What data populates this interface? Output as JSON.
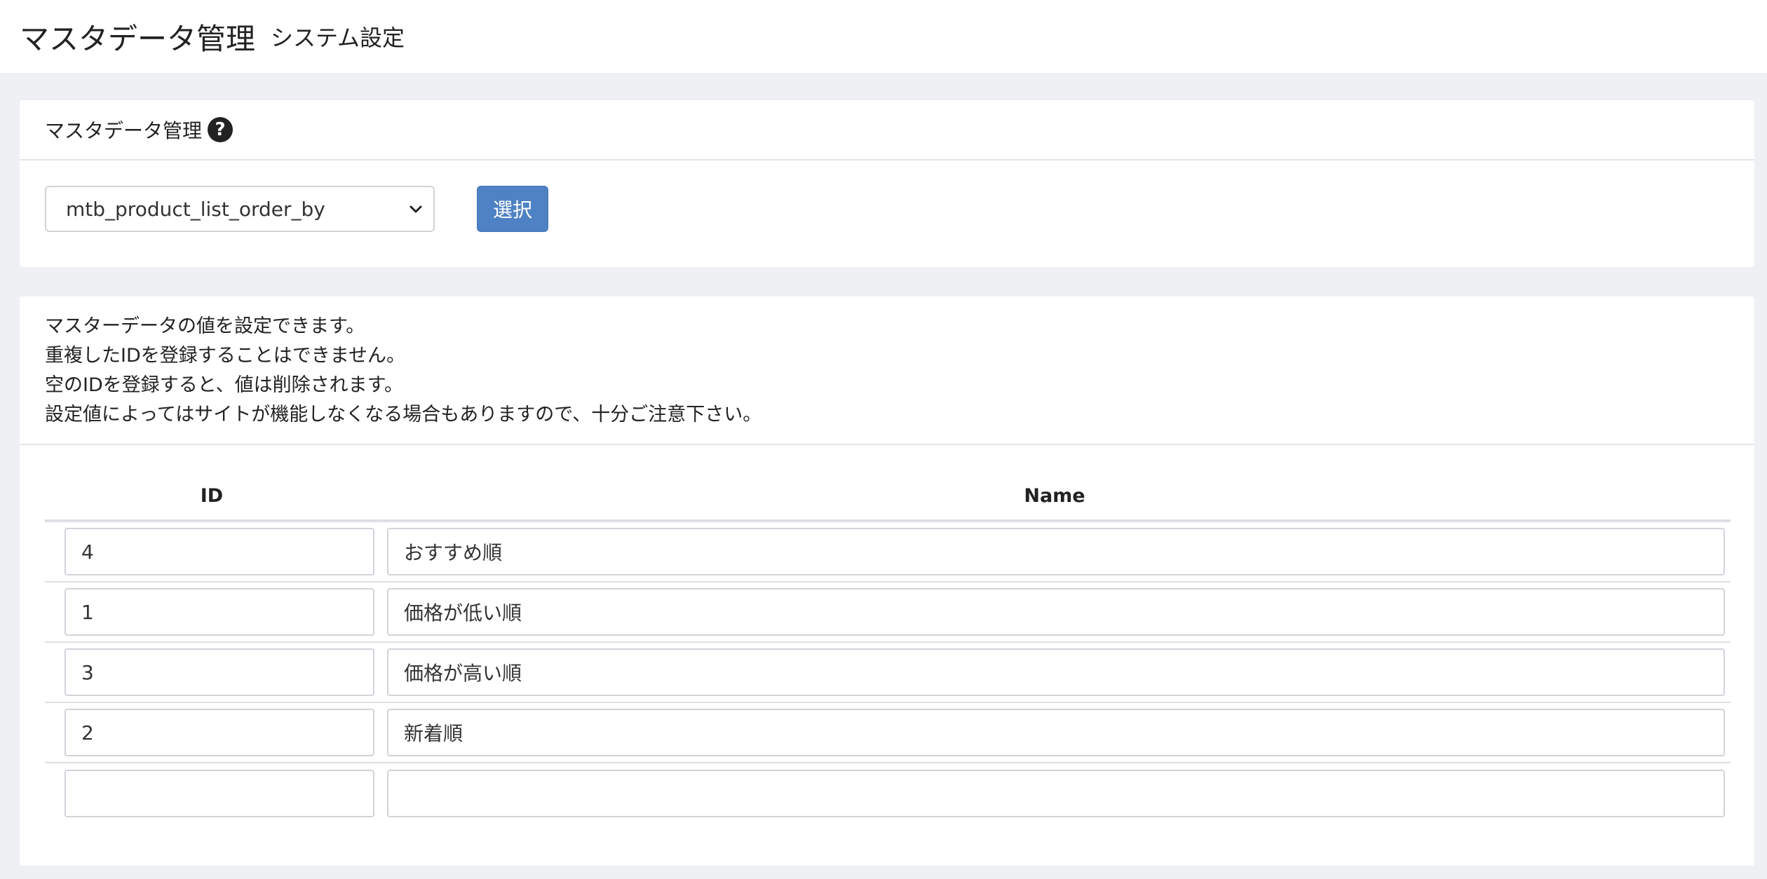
{
  "header": {
    "title": "マスタデータ管理",
    "subtitle": "システム設定"
  },
  "selector_card": {
    "title": "マスタデータ管理",
    "help_icon": "question-circle-icon",
    "selected_table": "mtb_product_list_order_by",
    "button_label": "選択"
  },
  "notice": {
    "lines": [
      "マスターデータの値を設定できます。",
      "重複したIDを登録することはできません。",
      "空のIDを登録すると、値は削除されます。",
      "設定値によってはサイトが機能しなくなる場合もありますので、十分ご注意下さい。"
    ]
  },
  "table": {
    "columns": [
      "ID",
      "Name"
    ],
    "rows": [
      {
        "id": "4",
        "name": "おすすめ順"
      },
      {
        "id": "1",
        "name": "価格が低い順"
      },
      {
        "id": "3",
        "name": "価格が高い順"
      },
      {
        "id": "2",
        "name": "新着順"
      },
      {
        "id": "",
        "name": ""
      }
    ]
  },
  "colors": {
    "primary_button": "#4f82c4",
    "page_bg": "#eef0f4"
  }
}
